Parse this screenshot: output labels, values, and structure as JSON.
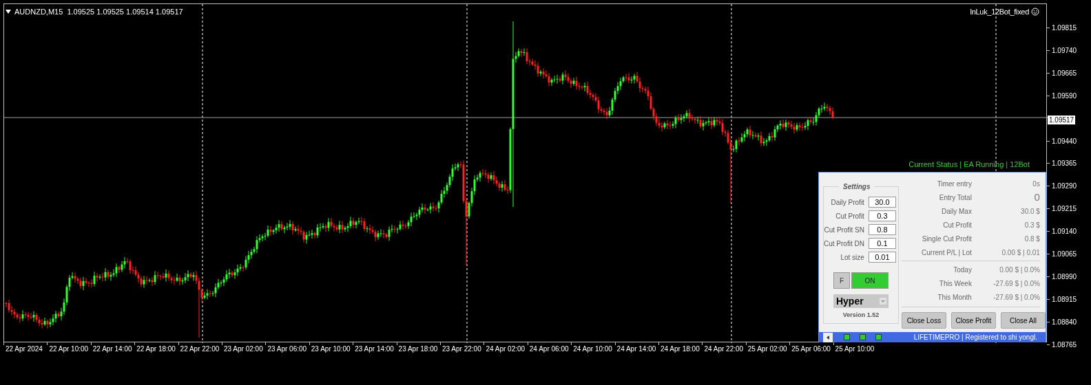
{
  "chart": {
    "symbol_line": "AUDNZD,M15  1.09525 1.09525 1.09514 1.09517",
    "expert_name": "lnLuk_12Bot_fixed",
    "status_text": "Current Status | EA Running | 12Bot",
    "current_price": "1.09517",
    "price_ticks": [
      "1.09815",
      "1.09740",
      "1.09665",
      "1.09590",
      "1.09440",
      "1.09365",
      "1.09290",
      "1.09215",
      "1.09140",
      "1.09065",
      "1.08990",
      "1.08915",
      "1.08840",
      "1.08765"
    ],
    "time_ticks": [
      "22 Apr 2024",
      "22 Apr 10:00",
      "22 Apr 14:00",
      "22 Apr 18:00",
      "22 Apr 22:00",
      "23 Apr 02:00",
      "23 Apr 06:00",
      "23 Apr 10:00",
      "23 Apr 14:00",
      "23 Apr 18:00",
      "23 Apr 22:00",
      "24 Apr 02:00",
      "24 Apr 06:00",
      "24 Apr 10:00",
      "24 Apr 14:00",
      "24 Apr 18:00",
      "24 Apr 22:00",
      "25 Apr 02:00",
      "25 Apr 06:00",
      "25 Apr 10:00"
    ]
  },
  "panel": {
    "settings_title": "Settings",
    "settings": [
      {
        "label": "Daily Profit",
        "value": "30.0"
      },
      {
        "label": "Cut Profit",
        "value": "0.3"
      },
      {
        "label": "Cut Profit SN",
        "value": "0.8"
      },
      {
        "label": "Cut Profit DN",
        "value": "0.1"
      },
      {
        "label": "Lot size",
        "value": "0.01"
      }
    ],
    "f_button": "F",
    "on_button": {
      "label": "ON",
      "on": true
    },
    "mode": "Hyper",
    "version": "Version 1.52",
    "stats": [
      {
        "label": "Timer entry",
        "value": "0s",
        "kind": "small"
      },
      {
        "label": "Entry Total",
        "value": "0",
        "kind": "large"
      },
      {
        "label": "Daily Max",
        "value": "30.0 $",
        "kind": "small"
      },
      {
        "label": "Cut Profit",
        "value": "0.3 $",
        "kind": "small"
      },
      {
        "label": "Single Cut Profit",
        "value": "0.8 $",
        "kind": "small"
      },
      {
        "label": "Current P/L | Lot",
        "value": "0.00 $ | 0.01",
        "kind": "small"
      }
    ],
    "period_stats": [
      {
        "label": "Today",
        "value": "0.00 $ | 0.0%"
      },
      {
        "label": "This Week",
        "value": "-27.69 $ | 0.0%"
      },
      {
        "label": "This Month",
        "value": "-27.69 $ | 0.0%"
      }
    ],
    "buttons": [
      "Close Loss",
      "Close Profit",
      "Close All"
    ],
    "footer": {
      "text": "LIFETIMEPRO | Registered to shi yongl."
    }
  }
}
